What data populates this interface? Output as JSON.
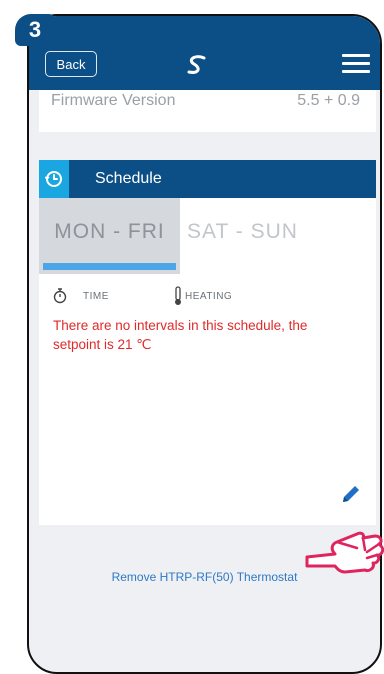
{
  "step": "3",
  "header": {
    "back_label": "Back",
    "logo": "salus-s-logo",
    "menu_icon": "hamburger-menu-icon"
  },
  "firmware": {
    "label": "Firmware Version",
    "value": "5.5 + 0.9"
  },
  "schedule": {
    "title": "Schedule",
    "icon": "schedule-clock-icon",
    "tabs": [
      {
        "label": "MON - FRI",
        "selected": true
      },
      {
        "label": "SAT - SUN",
        "selected": false
      }
    ],
    "legend": {
      "time_label": "TIME",
      "heating_label": "HEATING"
    },
    "message": "There are no intervals in this schedule, the setpoint is 21 ℃",
    "edit_icon": "pencil-icon"
  },
  "remove_link": "Remove HTRP-RF(50) Thermostat",
  "colors": {
    "primary": "#0c4f86",
    "accent": "#1aa6e0",
    "alert": "#e02a2a",
    "link": "#2f79c6",
    "tab_selected_bg": "#d5d8dc"
  }
}
